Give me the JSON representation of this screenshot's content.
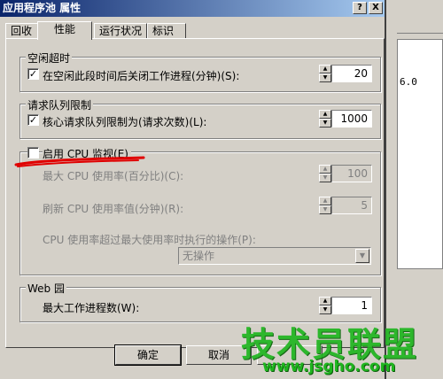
{
  "window": {
    "title": "应用程序池 属性"
  },
  "background": {
    "partial_text": "6.0"
  },
  "title_buttons": {
    "help": "?",
    "close": "X"
  },
  "tabs": [
    {
      "label": "回收"
    },
    {
      "label": "性能"
    },
    {
      "label": "运行状况"
    },
    {
      "label": "标识"
    }
  ],
  "idle_timeout": {
    "legend": "空闲超时",
    "checkbox_label": "在空闲此段时间后关闭工作进程(分钟)(S):",
    "checked": true,
    "value": "20"
  },
  "request_queue": {
    "legend": "请求队列限制",
    "checkbox_label": "核心请求队列限制为(请求次数)(L):",
    "checked": true,
    "value": "1000"
  },
  "cpu": {
    "checkbox_label": "启用 CPU 监视(E)",
    "checked": false,
    "max_label": "最大 CPU 使用率(百分比)(C):",
    "max_value": "100",
    "refresh_label": "刷新 CPU 使用率值(分钟)(R):",
    "refresh_value": "5",
    "action_label": "CPU 使用率超过最大使用率时执行的操作(P):",
    "action_value": "无操作"
  },
  "web_garden": {
    "legend": "Web 园",
    "label": "最大工作进程数(W):",
    "value": "1"
  },
  "buttons": {
    "ok": "确定",
    "cancel": "取消"
  },
  "watermark": {
    "text": "技术员联盟",
    "url": "www.jsgho.com"
  },
  "colors": {
    "title_start": "#0a246a",
    "title_end": "#a6caf0",
    "annotation": "#e00000",
    "watermark": "#1fb51f"
  }
}
